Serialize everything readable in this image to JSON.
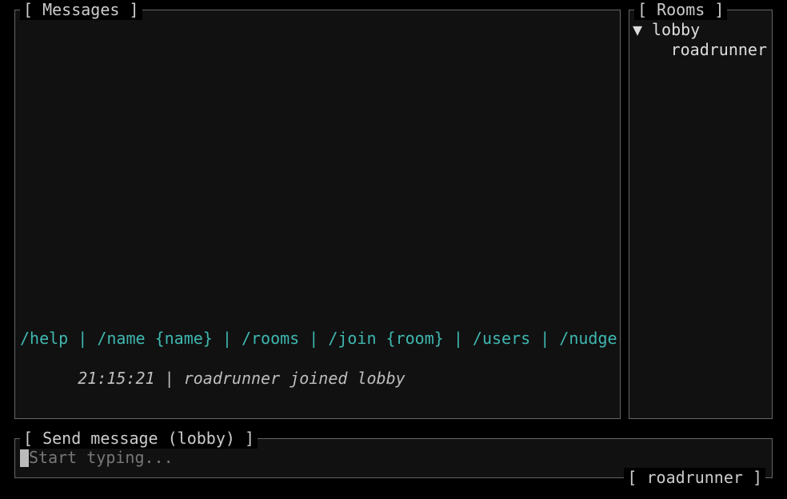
{
  "messages": {
    "title": "[ Messages ]",
    "help_line": "/help | /name {name} | /rooms | /join {room} | /users | /nudge",
    "status_time": "21:15:21",
    "status_sep": " | ",
    "status_text": "roadrunner joined lobby"
  },
  "rooms": {
    "title": "[ Rooms ]",
    "items": [
      {
        "marker": "▼",
        "name": "lobby",
        "users": [
          "roadrunner"
        ]
      }
    ]
  },
  "input": {
    "title": "[ Send message (lobby) ]",
    "placeholder": "Start typing...",
    "value": "",
    "footer_label": "[ roadrunner ]"
  }
}
